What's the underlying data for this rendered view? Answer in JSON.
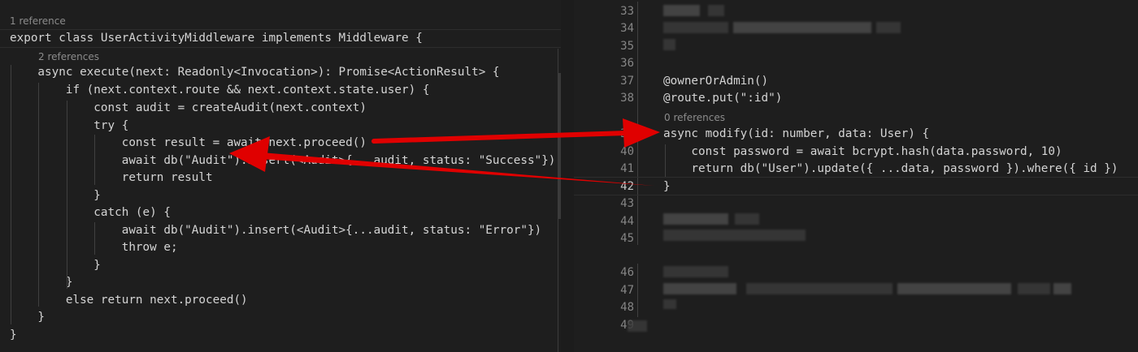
{
  "left": {
    "codelens_class": "1 reference",
    "codelens_method": "2 references",
    "lines": [
      "export class UserActivityMiddleware implements Middleware {",
      "    async execute(next: Readonly<Invocation>): Promise<ActionResult> {",
      "        if (next.context.route && next.context.state.user) {",
      "            const audit = createAudit(next.context)",
      "            try {",
      "                const result = await next.proceed()",
      "                await db(\"Audit\").insert(<Audit>{...audit, status: \"Success\"})",
      "                return result",
      "            }",
      "            catch (e) {",
      "                await db(\"Audit\").insert(<Audit>{...audit, status: \"Error\"})",
      "                throw e;",
      "            }",
      "        }",
      "        else return next.proceed()",
      "    }",
      "}"
    ]
  },
  "right": {
    "line_numbers": [
      "33",
      "34",
      "35",
      "36",
      "37",
      "38",
      "39",
      "40",
      "41",
      "42",
      "43",
      "44",
      "45",
      "46",
      "47",
      "48",
      "49"
    ],
    "codelens_method": "0 references",
    "lines": {
      "37": "@ownerOrAdmin()",
      "38": "@route.put(\":id\")",
      "39": "async modify(id: number, data: User) {",
      "40": "    const password = await bcrypt.hash(data.password, 10)",
      "41": "    return db(\"User\").update({ ...data, password }).where({ id })",
      "42": "}"
    }
  },
  "colors": {
    "background": "#1e1e1e",
    "text": "#d4d4d4",
    "line_number": "#858585",
    "codelens": "#8c8c8c",
    "arrow": "#e00000"
  }
}
